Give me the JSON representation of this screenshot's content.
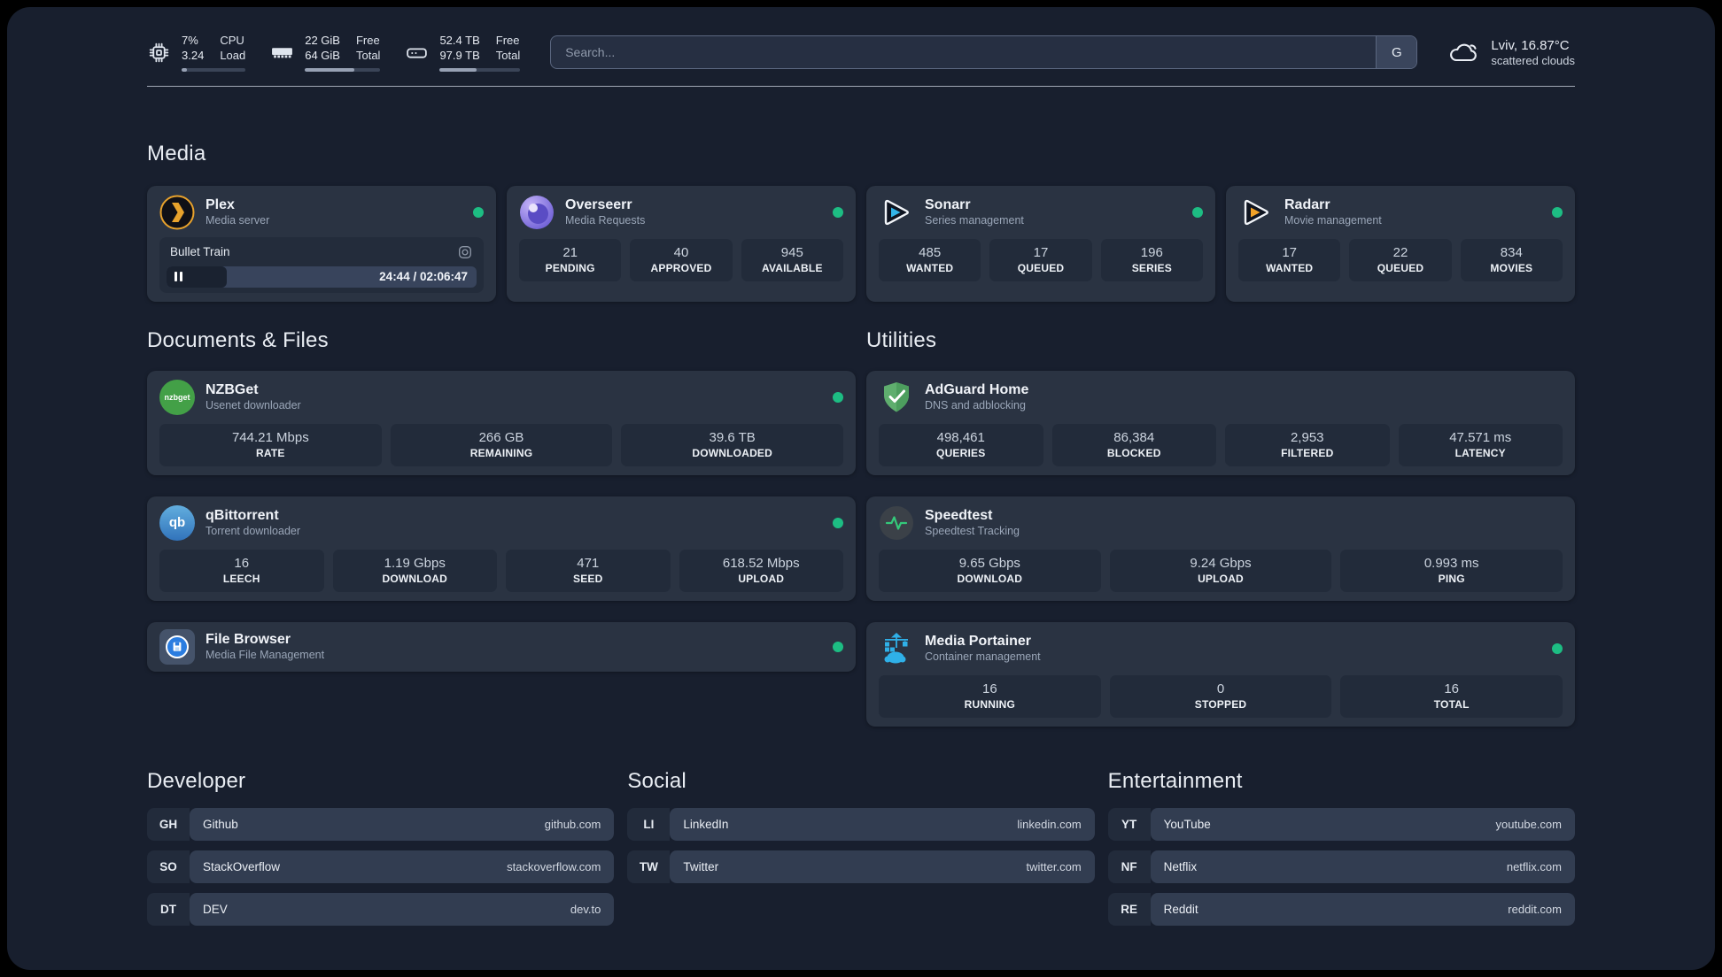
{
  "header": {
    "system_stats": [
      {
        "icon": "cpu-icon",
        "col1_top": "7%",
        "col1_bottom": "3.24",
        "col2_top": "CPU",
        "col2_bottom": "Load",
        "progress_pct": 8
      },
      {
        "icon": "memory-icon",
        "col1_top": "22 GiB",
        "col1_bottom": "64 GiB",
        "col2_top": "Free",
        "col2_bottom": "Total",
        "progress_pct": 66
      },
      {
        "icon": "disk-icon",
        "col1_top": "52.4 TB",
        "col1_bottom": "97.9 TB",
        "col2_top": "Free",
        "col2_bottom": "Total",
        "progress_pct": 46
      }
    ],
    "search": {
      "placeholder": "Search...",
      "engine_button_label": "G"
    },
    "weather": {
      "icon": "cloud-icon",
      "location_temperature": "Lviv, 16.87°C",
      "condition": "scattered clouds"
    }
  },
  "sections": {
    "media": {
      "title": "Media",
      "apps": [
        {
          "name": "Plex",
          "subtitle": "Media server",
          "online": true,
          "now_playing": {
            "title": "Bullet Train",
            "time_display": "24:44 / 02:06:47",
            "progress_pct": 19.5,
            "state": "paused"
          }
        },
        {
          "name": "Overseerr",
          "subtitle": "Media Requests",
          "online": true,
          "stats": [
            {
              "value": "21",
              "label": "PENDING"
            },
            {
              "value": "40",
              "label": "APPROVED"
            },
            {
              "value": "945",
              "label": "AVAILABLE"
            }
          ]
        },
        {
          "name": "Sonarr",
          "subtitle": "Series management",
          "online": true,
          "stats": [
            {
              "value": "485",
              "label": "WANTED"
            },
            {
              "value": "17",
              "label": "QUEUED"
            },
            {
              "value": "196",
              "label": "SERIES"
            }
          ]
        },
        {
          "name": "Radarr",
          "subtitle": "Movie management",
          "online": true,
          "stats": [
            {
              "value": "17",
              "label": "WANTED"
            },
            {
              "value": "22",
              "label": "QUEUED"
            },
            {
              "value": "834",
              "label": "MOVIES"
            }
          ]
        }
      ]
    },
    "documents_files": {
      "title": "Documents & Files",
      "apps": [
        {
          "name": "NZBGet",
          "subtitle": "Usenet downloader",
          "online": true,
          "icon_text": "nzbget",
          "stats": [
            {
              "value": "744.21 Mbps",
              "label": "RATE"
            },
            {
              "value": "266 GB",
              "label": "REMAINING"
            },
            {
              "value": "39.6 TB",
              "label": "DOWNLOADED"
            }
          ]
        },
        {
          "name": "qBittorrent",
          "subtitle": "Torrent downloader",
          "online": true,
          "icon_text": "qb",
          "stats": [
            {
              "value": "16",
              "label": "LEECH"
            },
            {
              "value": "1.19 Gbps",
              "label": "DOWNLOAD"
            },
            {
              "value": "471",
              "label": "SEED"
            },
            {
              "value": "618.52 Mbps",
              "label": "UPLOAD"
            }
          ]
        },
        {
          "name": "File Browser",
          "subtitle": "Media File Management",
          "online": true
        }
      ]
    },
    "utilities": {
      "title": "Utilities",
      "apps": [
        {
          "name": "AdGuard Home",
          "subtitle": "DNS and adblocking",
          "stats": [
            {
              "value": "498,461",
              "label": "QUERIES"
            },
            {
              "value": "86,384",
              "label": "BLOCKED"
            },
            {
              "value": "2,953",
              "label": "FILTERED"
            },
            {
              "value": "47.571 ms",
              "label": "LATENCY"
            }
          ]
        },
        {
          "name": "Speedtest",
          "subtitle": "Speedtest Tracking",
          "stats": [
            {
              "value": "9.65 Gbps",
              "label": "DOWNLOAD"
            },
            {
              "value": "9.24 Gbps",
              "label": "UPLOAD"
            },
            {
              "value": "0.993 ms",
              "label": "PING"
            }
          ]
        },
        {
          "name": "Media Portainer",
          "subtitle": "Container management",
          "online": true,
          "stats": [
            {
              "value": "16",
              "label": "RUNNING"
            },
            {
              "value": "0",
              "label": "STOPPED"
            },
            {
              "value": "16",
              "label": "TOTAL"
            }
          ]
        }
      ]
    },
    "link_groups": [
      {
        "title": "Developer",
        "links": [
          {
            "abbr": "GH",
            "name": "Github",
            "url": "github.com"
          },
          {
            "abbr": "SO",
            "name": "StackOverflow",
            "url": "stackoverflow.com"
          },
          {
            "abbr": "DT",
            "name": "DEV",
            "url": "dev.to"
          }
        ]
      },
      {
        "title": "Social",
        "links": [
          {
            "abbr": "LI",
            "name": "LinkedIn",
            "url": "linkedin.com"
          },
          {
            "abbr": "TW",
            "name": "Twitter",
            "url": "twitter.com"
          }
        ]
      },
      {
        "title": "Entertainment",
        "links": [
          {
            "abbr": "YT",
            "name": "YouTube",
            "url": "youtube.com"
          },
          {
            "abbr": "NF",
            "name": "Netflix",
            "url": "netflix.com"
          },
          {
            "abbr": "RE",
            "name": "Reddit",
            "url": "reddit.com"
          }
        ]
      }
    ]
  },
  "colors": {
    "status_online": "#1dbd83",
    "background": "#181f2e",
    "card": "#2a3342",
    "portainer_blue": "#2fb0e8",
    "adguard_green": "#5fae6e"
  }
}
